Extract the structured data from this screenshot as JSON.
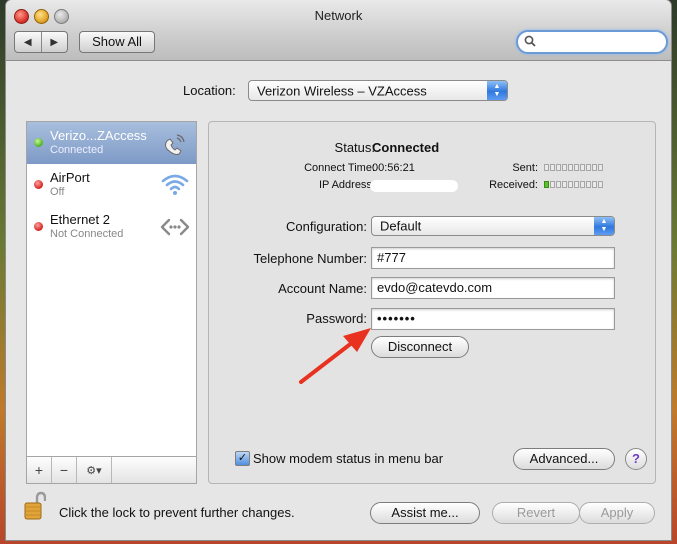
{
  "window": {
    "title": "Network"
  },
  "toolbar": {
    "back_glyph": "◀",
    "forward_glyph": "▶",
    "show_all_label": "Show All",
    "search_placeholder": ""
  },
  "location": {
    "label": "Location:",
    "value": "Verizon Wireless – VZAccess"
  },
  "services": [
    {
      "name": "Verizo...ZAccess",
      "status": "Connected",
      "status_color": "green",
      "icon": "phone-modem-icon",
      "selected": true
    },
    {
      "name": "AirPort",
      "status": "Off",
      "status_color": "red",
      "icon": "wifi-icon",
      "selected": false
    },
    {
      "name": "Ethernet 2",
      "status": "Not Connected",
      "status_color": "red",
      "icon": "ethernet-icon",
      "selected": false
    }
  ],
  "sidebar_controls": {
    "add": "+",
    "remove": "−",
    "gear": "⚙▾"
  },
  "detail": {
    "status_label": "Status:",
    "status_value": "Connected",
    "connect_time_label": "Connect Time:",
    "connect_time_value": "00:56:21",
    "ip_address_label": "IP Address:",
    "sent_label": "Sent:",
    "received_label": "Received:",
    "sent_level": 0,
    "received_level": 1,
    "meter_segments": 10,
    "configuration_label": "Configuration:",
    "configuration_value": "Default",
    "telephone_label": "Telephone Number:",
    "telephone_value": "#777",
    "account_label": "Account Name:",
    "account_value": "evdo@catevdo.com",
    "password_label": "Password:",
    "password_value": "•••••••",
    "disconnect_label": "Disconnect",
    "show_modem_label": "Show modem status in menu bar",
    "show_modem_checked": true,
    "advanced_label": "Advanced...",
    "help_label": "?"
  },
  "footer": {
    "lock_text": "Click the lock to prevent further changes.",
    "assist_label": "Assist me...",
    "revert_label": "Revert",
    "apply_label": "Apply"
  },
  "colors": {
    "selection": "#7d9ac6",
    "arrow": "#e8321f",
    "focus_ring": "#6a9bd7"
  }
}
